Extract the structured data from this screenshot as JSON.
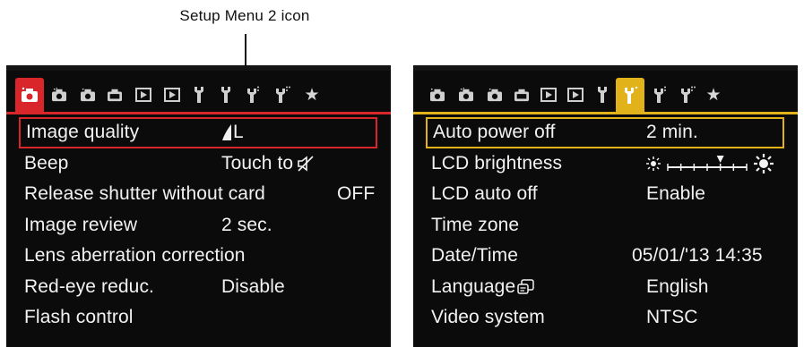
{
  "annotation": {
    "text": "Setup Menu 2 icon"
  },
  "left_screen": {
    "tabs": [
      {
        "icon": "camera-icon",
        "active": true
      },
      {
        "icon": "camera-icon"
      },
      {
        "icon": "camera-icon"
      },
      {
        "icon": "camera-icon"
      },
      {
        "icon": "playback-icon"
      },
      {
        "icon": "playback-icon"
      },
      {
        "icon": "wrench-icon"
      },
      {
        "icon": "wrench-icon"
      },
      {
        "icon": "wrench-icon"
      },
      {
        "icon": "wrench-icon"
      },
      {
        "text": "★",
        "icon": "star-icon"
      }
    ],
    "items": [
      {
        "label": "Image quality",
        "value": "L",
        "selected": true
      },
      {
        "label": "Beep",
        "value": "Touch to"
      },
      {
        "label": "Release shutter without card",
        "value": "OFF"
      },
      {
        "label": "Image review",
        "value": "2 sec."
      },
      {
        "label": "Lens aberration correction",
        "value": ""
      },
      {
        "label": "Red-eye reduc.",
        "value": "Disable"
      },
      {
        "label": "Flash control",
        "value": ""
      }
    ]
  },
  "right_screen": {
    "tabs": [
      {
        "icon": "camera-icon"
      },
      {
        "icon": "camera-icon"
      },
      {
        "icon": "camera-icon"
      },
      {
        "icon": "camera-icon"
      },
      {
        "icon": "playback-icon"
      },
      {
        "icon": "playback-icon"
      },
      {
        "icon": "wrench-icon"
      },
      {
        "icon": "wrench-icon",
        "active": true
      },
      {
        "icon": "wrench-icon"
      },
      {
        "icon": "wrench-icon"
      },
      {
        "text": "★",
        "icon": "star-icon"
      }
    ],
    "items": [
      {
        "label": "Auto power off",
        "value": "2 min.",
        "selected": true
      },
      {
        "label": "LCD brightness",
        "value": ""
      },
      {
        "label": "LCD auto off",
        "value": "Enable"
      },
      {
        "label": "Time zone",
        "value": ""
      },
      {
        "label": "Date/Time",
        "value": "05/01/'13 14:35"
      },
      {
        "label": "Language",
        "value": "English"
      },
      {
        "label": "Video system",
        "value": "NTSC"
      }
    ],
    "brightness_level": 5,
    "brightness_steps": 7
  },
  "colors": {
    "shoot_accent": "#d9262a",
    "setup_accent": "#e2b21a",
    "screen_bg": "#0b0b0b"
  }
}
